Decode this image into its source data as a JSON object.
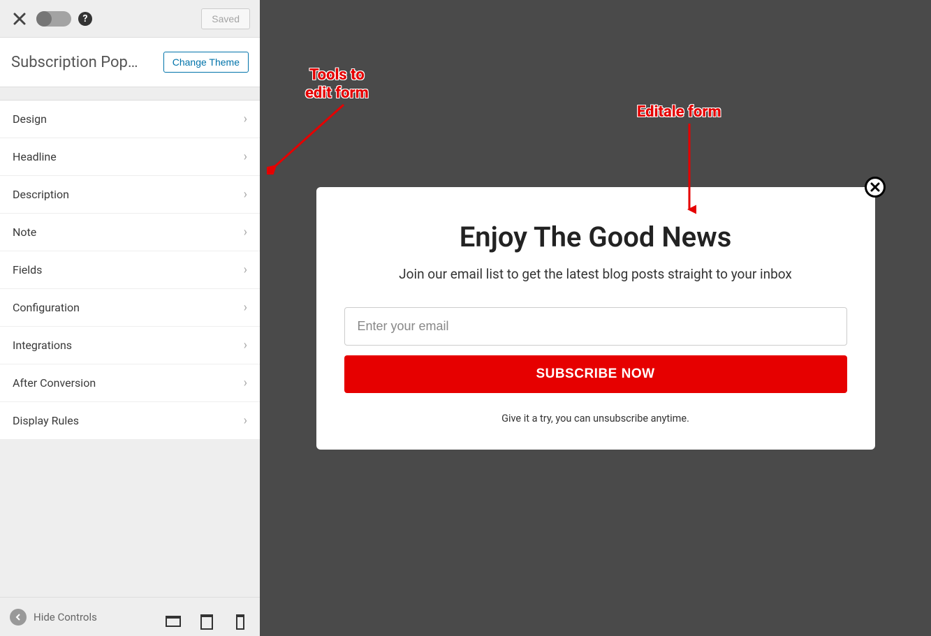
{
  "header": {
    "saved_label": "Saved"
  },
  "title": "Subscription Pop…",
  "change_theme_label": "Change Theme",
  "menu": [
    {
      "label": "Design"
    },
    {
      "label": "Headline"
    },
    {
      "label": "Description"
    },
    {
      "label": "Note"
    },
    {
      "label": "Fields"
    },
    {
      "label": "Configuration"
    },
    {
      "label": "Integrations"
    },
    {
      "label": "After Conversion"
    },
    {
      "label": "Display Rules"
    }
  ],
  "footer": {
    "hide_controls_label": "Hide Controls"
  },
  "popup": {
    "headline": "Enjoy The Good News",
    "description": "Join our email list to get the latest blog posts straight to your inbox",
    "email_placeholder": "Enter your email",
    "button_label": "SUBSCRIBE NOW",
    "note": "Give it a try, you can unsubscribe anytime."
  },
  "annotations": {
    "tools": "Tools to\nedit form",
    "editable": "Editale form"
  },
  "colors": {
    "accent_red": "#e60000",
    "link_blue": "#0073aa",
    "preview_bg": "#4a4a4a"
  }
}
